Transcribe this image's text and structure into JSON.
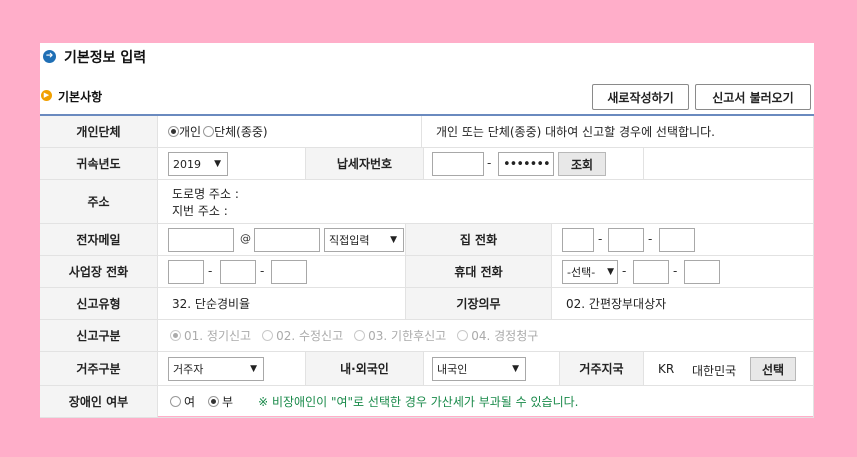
{
  "page_title": "기본정보 입력",
  "section_title": "기본사항",
  "buttons": {
    "new": "새로작성하기",
    "load": "신고서 불러오기"
  },
  "rows": {
    "individual_group": {
      "label": "개인단체",
      "opt_individual": "개인",
      "opt_group": "단체(종중)",
      "selected": "개인",
      "help": "개인 또는 단체(종중) 대하여 신고할 경우에 선택합니다."
    },
    "year": {
      "label": "귀속년도",
      "value": "2019"
    },
    "taxpayer_id": {
      "label": "납세자번호",
      "part1": "",
      "part2": "•••••••",
      "lookup": "조회"
    },
    "address": {
      "label": "주소",
      "road": "도로명 주소 :",
      "lot": "지번 주소 :"
    },
    "email": {
      "label": "전자메일",
      "user": "",
      "at": "@",
      "domain": "",
      "domain_select": "직접입력"
    },
    "home_phone": {
      "label": "집 전화",
      "p1": "",
      "p2": "",
      "p3": ""
    },
    "biz_phone": {
      "label": "사업장 전화",
      "p1": "",
      "p2": "",
      "p3": ""
    },
    "mobile": {
      "label": "휴대 전화",
      "select": "-선택-",
      "p2": "",
      "p3": ""
    },
    "report_type": {
      "label": "신고유형",
      "value": "32. 단순경비율"
    },
    "bookkeeping": {
      "label": "기장의무",
      "value": "02. 간편장부대상자"
    },
    "report_class": {
      "label": "신고구분",
      "options": [
        "01. 정기신고",
        "02. 수정신고",
        "03. 기한후신고",
        "04. 경정청구"
      ],
      "selected": "01. 정기신고"
    },
    "residency": {
      "label": "거주구분",
      "value": "거주자"
    },
    "nationality": {
      "label": "내·외국인",
      "value": "내국인"
    },
    "country": {
      "label": "거주지국",
      "code": "KR",
      "name": "대한민국",
      "select_btn": "선택"
    },
    "disabled": {
      "label": "장애인 여부",
      "opt_yes": "여",
      "opt_no": "부",
      "selected": "부",
      "note": "※ 비장애인이 \"여\"로 선택한 경우 가산세가 부과될 수 있습니다."
    }
  },
  "colors": {
    "background": "#ffaec9",
    "accent": "#1f6fb5",
    "note_green": "#1a8a4a"
  }
}
